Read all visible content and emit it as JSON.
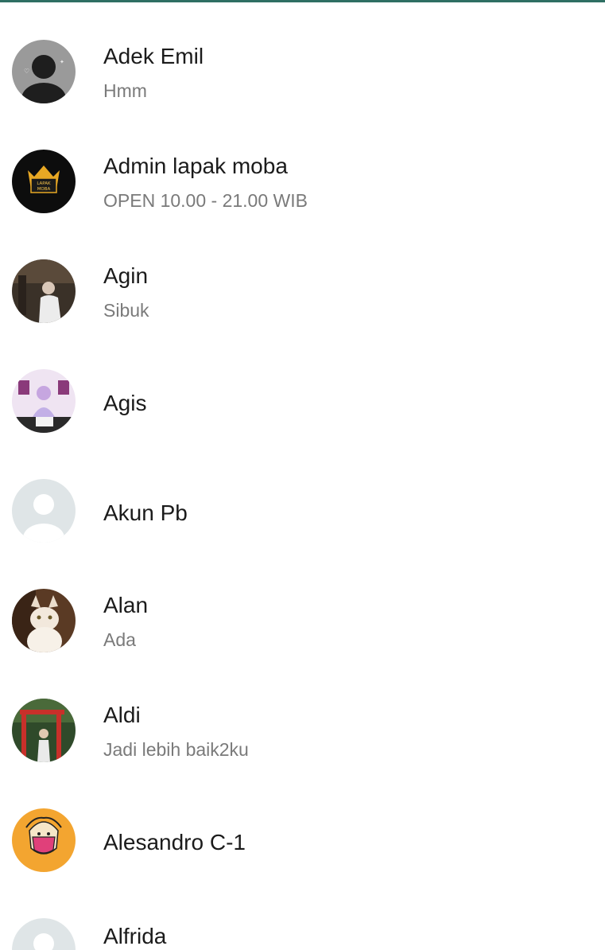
{
  "contacts": [
    {
      "name": "Adek Emil",
      "status": "Hmm",
      "avatar_icon": "dark-silhouette-avatar-icon"
    },
    {
      "name": "Admin lapak moba",
      "status": "OPEN 10.00 - 21.00 WIB",
      "avatar_icon": "lapak-moba-logo-icon",
      "logo_text": "LAPAK MOBA"
    },
    {
      "name": "Agin",
      "status": "Sibuk",
      "avatar_icon": "photo-avatar-icon"
    },
    {
      "name": "Agis",
      "status": "",
      "avatar_icon": "photo-avatar-icon"
    },
    {
      "name": "Akun Pb",
      "status": "",
      "avatar_icon": "default-person-avatar-icon"
    },
    {
      "name": "Alan",
      "status": "Ada",
      "avatar_icon": "cat-photo-avatar-icon"
    },
    {
      "name": "Aldi",
      "status": "Jadi lebih baik2ku",
      "avatar_icon": "photo-avatar-icon"
    },
    {
      "name": "Alesandro C-1",
      "status": "",
      "avatar_icon": "illustration-avatar-icon"
    },
    {
      "name": "Alfrida",
      "status": "",
      "avatar_icon": "default-person-avatar-icon"
    }
  ],
  "colors": {
    "accent_line": "#2f6f63",
    "name_text": "#1b1b1b",
    "status_text": "#7a7a7a",
    "default_avatar_bg": "#dfe5e7"
  }
}
